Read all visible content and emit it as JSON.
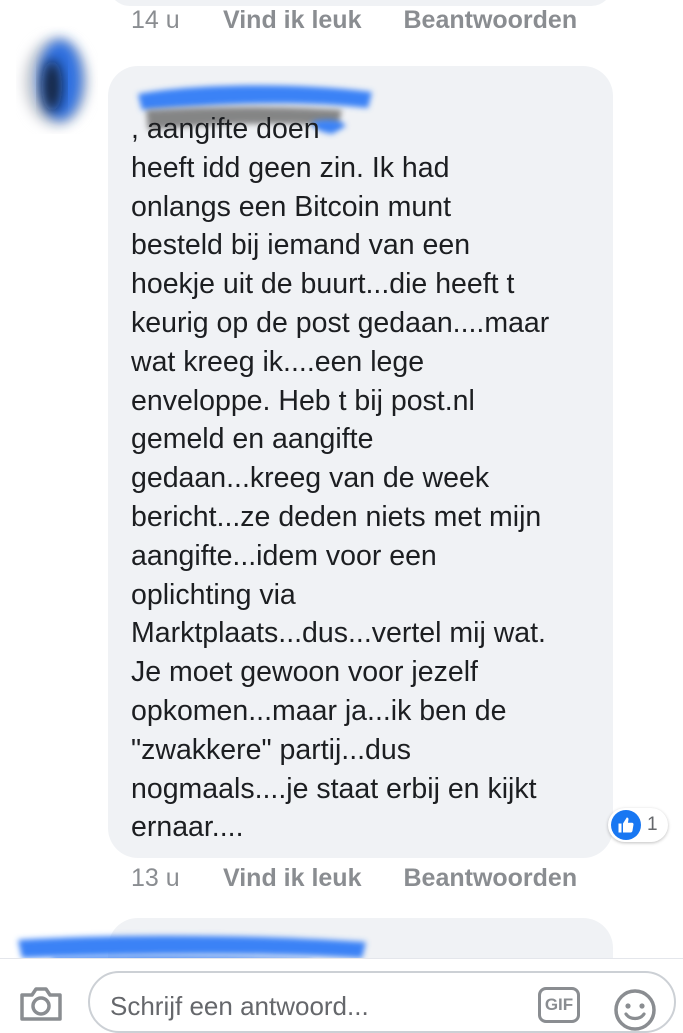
{
  "previous_comment": {
    "time": "14 u",
    "like_label": "Vind ik leuk",
    "reply_label": "Beantwoorden"
  },
  "comment": {
    "text": ", aangifte doen\nheeft idd geen zin. Ik had\nonlangs een Bitcoin munt\nbesteld bij iemand van een\nhoekje uit de buurt...die heeft t\nkeurig op de post gedaan....maar\nwat kreeg ik....een lege\nenveloppe. Heb t bij post.nl\ngemeld en aangifte\ngedaan...kreeg van de week\nbericht...ze deden niets met mijn\naangifte...idem voor een\noplichting via\nMarktplaats...dus...vertel mij wat.\nJe moet gewoon voor jezelf\nopkomen...maar ja...ik ben de\n\"zwakkere\" partij...dus\nnogmaals....je staat erbij en kijkt\nernaar....",
    "reaction_count": "1",
    "time": "13 u",
    "like_label": "Vind ik leuk",
    "reply_label": "Beantwoorden"
  },
  "composer": {
    "placeholder": "Schrijf een antwoord...",
    "gif_label": "GIF"
  },
  "colors": {
    "bubble": "#f0f2f5",
    "accent": "#1877f2",
    "meta": "#8a8d91",
    "redaction": "#3b82f6"
  },
  "icons": [
    "camera-icon",
    "like-icon",
    "gif-icon",
    "emoji-icon"
  ]
}
